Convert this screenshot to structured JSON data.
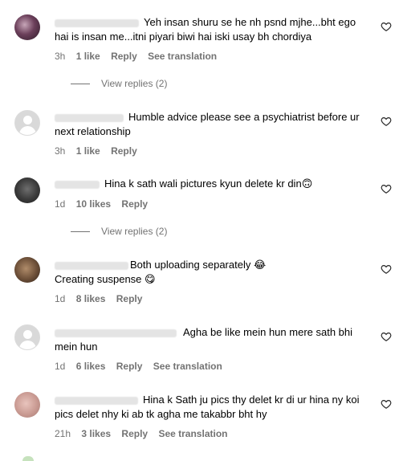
{
  "comments": [
    {
      "text": "Yeh insan shuru se he nh psnd mjhe...bht ego hai is insan me...itni piyari biwi hai iski usay bh chordiya",
      "time": "3h",
      "likes": "1 like",
      "reply": "Reply",
      "translation": "See translation",
      "view_replies": "View replies (2)"
    },
    {
      "text": "Humble advice please see a psychiatrist before ur next relationship",
      "time": "3h",
      "likes": "1 like",
      "reply": "Reply"
    },
    {
      "text": "Hina k sath wali pictures kyun delete kr din",
      "emoji": "🙃",
      "time": "1d",
      "likes": "10 likes",
      "reply": "Reply",
      "view_replies": "View replies (2)"
    },
    {
      "text_line1": "Both uploading separately",
      "emoji1": "😂",
      "text_line2": "Creating suspense",
      "emoji2": "😋",
      "time": "1d",
      "likes": "8 likes",
      "reply": "Reply"
    },
    {
      "text": "Agha be like mein hun mere sath bhi mein hun",
      "time": "1d",
      "likes": "6 likes",
      "reply": "Reply",
      "translation": "See translation"
    },
    {
      "text": "Hina k Sath ju pics thy delet kr di ur hina ny koi pics delet nhy ki ab tk agha me takabbr bht hy",
      "time": "21h",
      "likes": "3 likes",
      "reply": "Reply",
      "translation": "See translation"
    }
  ]
}
